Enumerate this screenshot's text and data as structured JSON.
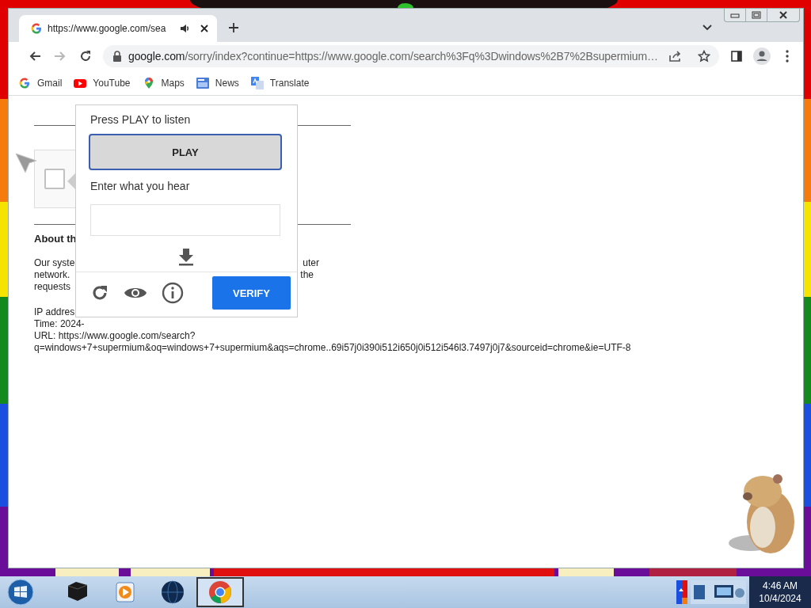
{
  "tabs": [
    {
      "title": "https://www.google.com/sea",
      "selected": true,
      "audio": true
    }
  ],
  "toolbar": {
    "url_host": "google.com",
    "url_rest": "/sorry/index?continue=https://www.google.com/search%3Fq%3Dwindows%2B7%2Bsupermium…",
    "forward_disabled": true
  },
  "bookmarks": [
    {
      "label": "Gmail",
      "kind": "g"
    },
    {
      "label": "YouTube",
      "kind": "video"
    },
    {
      "label": "Maps",
      "kind": "pin"
    },
    {
      "label": "News",
      "kind": "news"
    },
    {
      "label": "Translate",
      "kind": "translate"
    }
  ],
  "page": {
    "checkbox_checked": false,
    "heading": "About th",
    "lines": [
      {
        "left": "Our syste",
        "right": "uter"
      },
      {
        "left": "network.",
        "right": "the"
      },
      {
        "left": "requests"
      }
    ],
    "ip": "IP addres",
    "time": "Time: 2024-",
    "url": "URL: https://www.google.com/search?q=windows+7+supermium&oq=windows+7+supermium&aqs=chrome..69i57j0i390i512i650j0i512i546l3.7497j0j7&sourceid=chrome&ie=UTF-8"
  },
  "captcha": {
    "prompt": "Press PLAY to listen",
    "play": "PLAY",
    "input_label": "Enter what you hear",
    "verify": "VERIFY"
  },
  "taskbar": {
    "apps": [
      {
        "kind": "box",
        "selected": false
      },
      {
        "kind": "play",
        "selected": false
      },
      {
        "kind": "globe",
        "selected": false
      },
      {
        "kind": "browser",
        "selected": true
      }
    ],
    "time": "4:46 AM",
    "date": "10/4/2024"
  }
}
